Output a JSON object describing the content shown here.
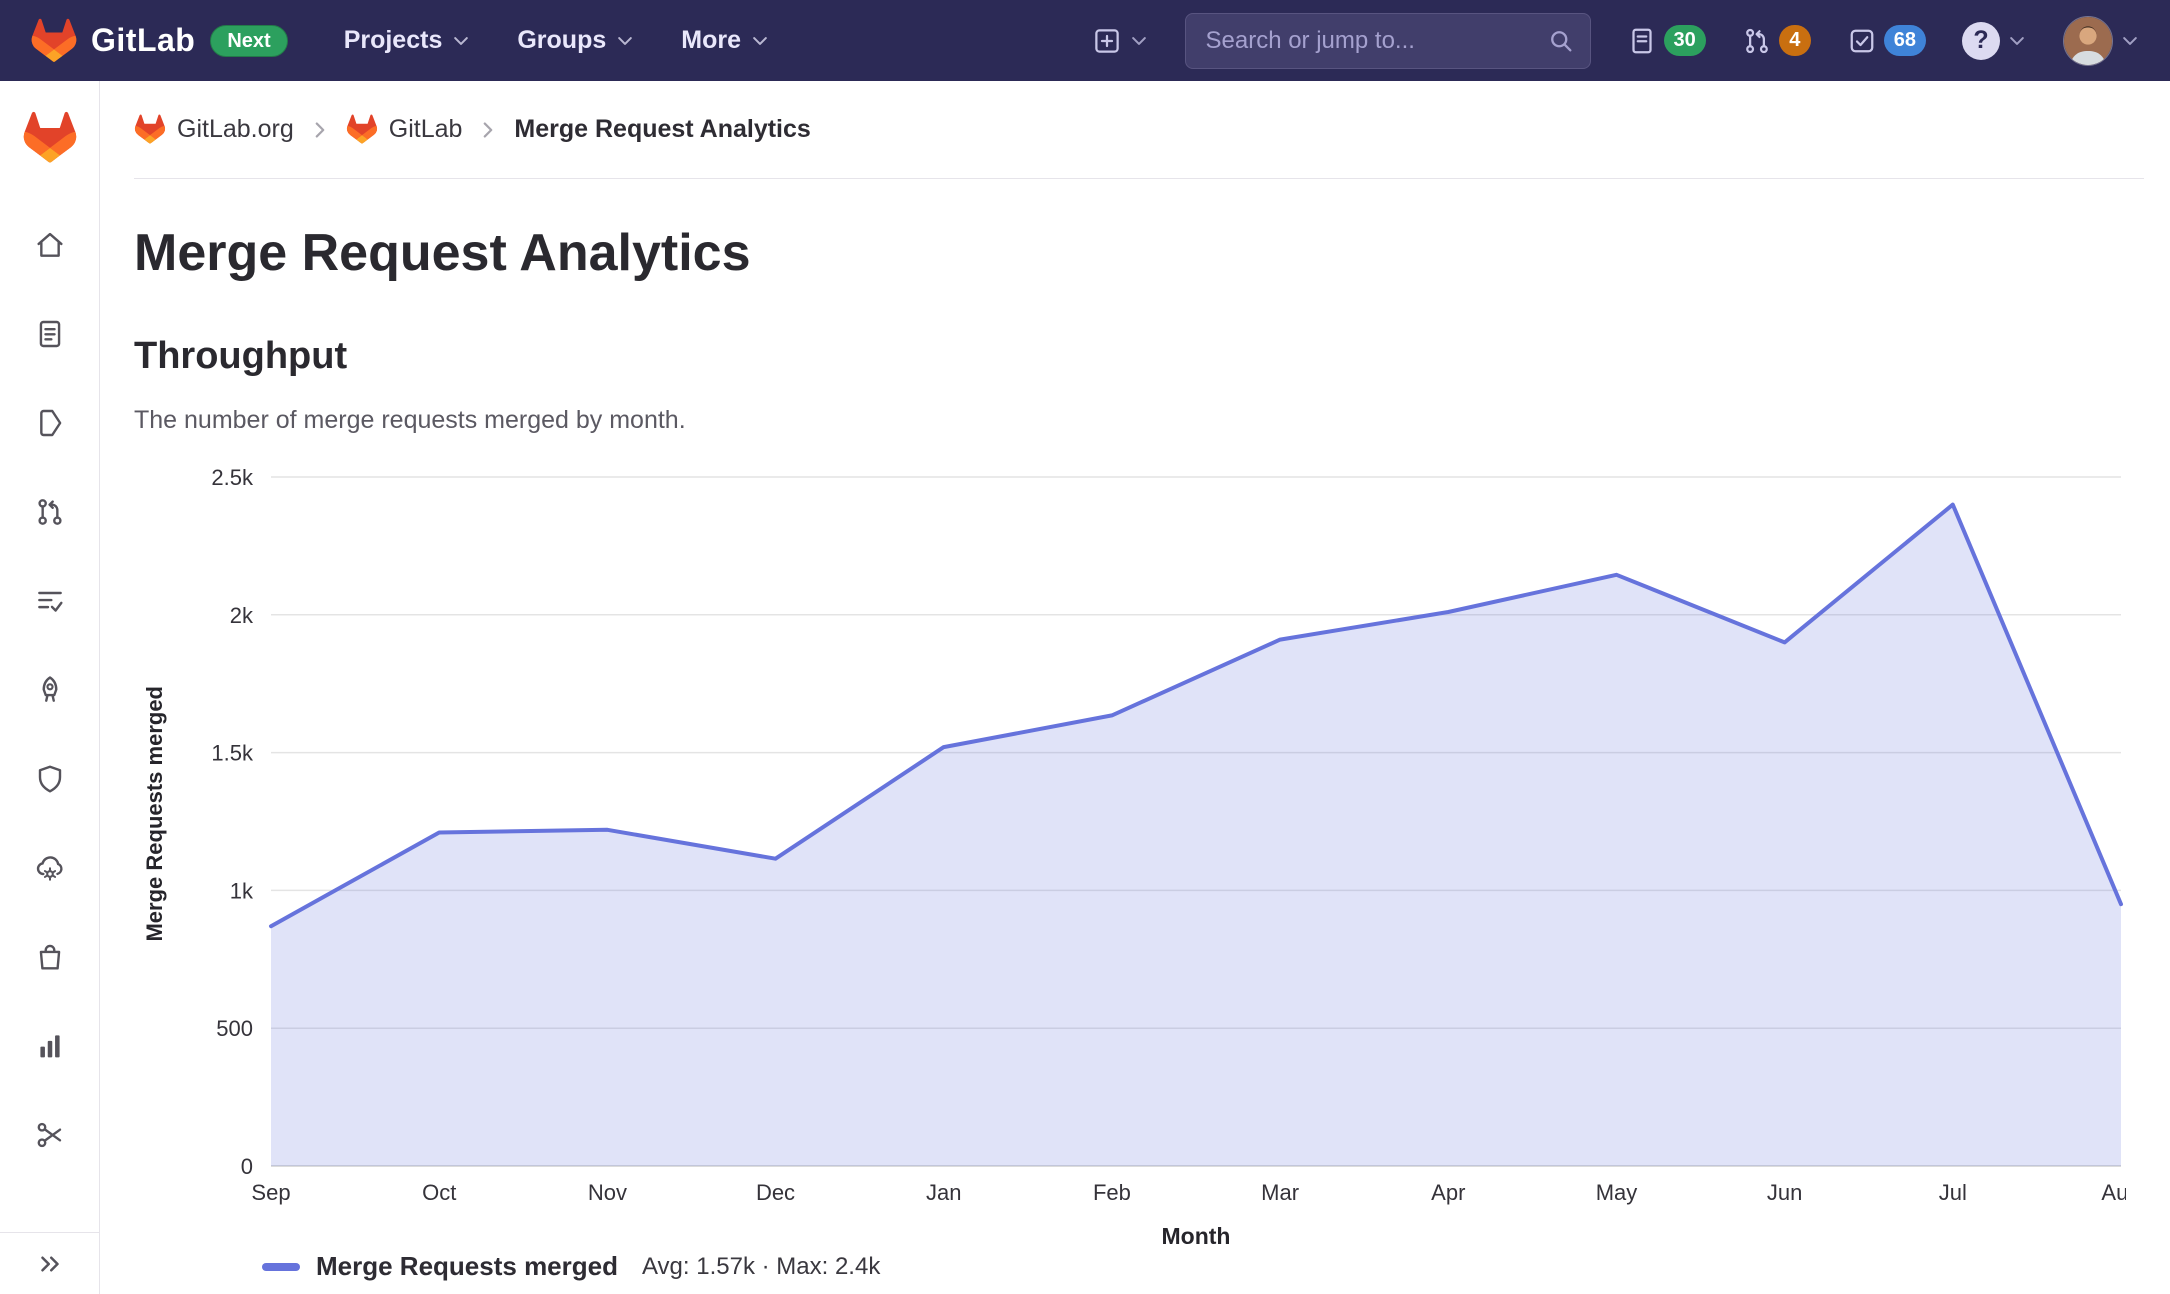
{
  "navbar": {
    "brand": "GitLab",
    "next_badge": "Next",
    "links": [
      {
        "label": "Projects"
      },
      {
        "label": "Groups"
      },
      {
        "label": "More"
      }
    ],
    "search_placeholder": "Search or jump to...",
    "counters": {
      "issues": "30",
      "merge_requests": "4",
      "todos": "68"
    },
    "help_glyph": "?"
  },
  "breadcrumb": {
    "items": [
      {
        "label": "GitLab.org"
      },
      {
        "label": "GitLab"
      }
    ],
    "current": "Merge Request Analytics"
  },
  "sidebar": {
    "icons": [
      "gitlab-tanuki",
      "home",
      "file-text",
      "bookmark-label",
      "merge-request",
      "list-check",
      "rocket",
      "shield",
      "cloud-gear",
      "bag",
      "bar-chart",
      "scissors",
      "collapse-double-chevron"
    ]
  },
  "page": {
    "title": "Merge Request Analytics",
    "section": "Throughput",
    "description": "The number of merge requests merged by month."
  },
  "chart_data": {
    "type": "area",
    "title": "Throughput",
    "x": [
      "Sep",
      "Oct",
      "Nov",
      "Dec",
      "Jan",
      "Feb",
      "Mar",
      "Apr",
      "May",
      "Jun",
      "Jul",
      "Aug"
    ],
    "series": [
      {
        "name": "Merge Requests merged",
        "values": [
          870,
          1210,
          1220,
          1115,
          1520,
          1635,
          1910,
          2010,
          2145,
          1900,
          2400,
          950
        ]
      }
    ],
    "xlabel": "Month",
    "ylabel": "Merge Requests merged",
    "ylim": [
      0,
      2500
    ],
    "yticks": [
      0,
      500,
      1000,
      1500,
      2000,
      2500
    ],
    "ytick_labels": [
      "0",
      "500",
      "1k",
      "1.5k",
      "2k",
      "2.5k"
    ],
    "grid": true,
    "legend_position": "bottom-left",
    "line_color": "#6673dc",
    "fill_color": "rgba(102,115,220,0.20)",
    "legend": {
      "label": "Merge Requests merged",
      "stats": "Avg: 1.57k · Max: 2.4k"
    }
  }
}
